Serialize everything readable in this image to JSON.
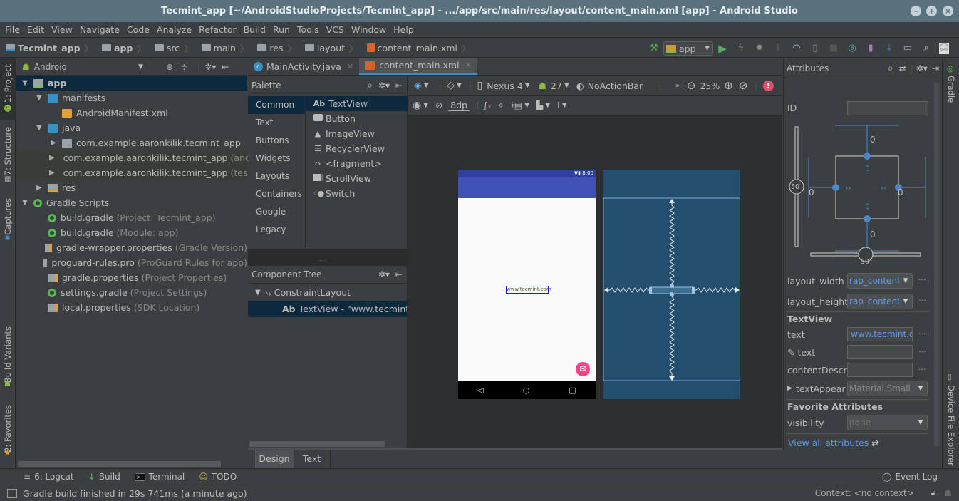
{
  "window": {
    "title": "Tecmint_app [~/AndroidStudioProjects/Tecmint_app] - .../app/src/main/res/layout/content_main.xml [app] - Android Studio",
    "controls": [
      "minimize",
      "maximize",
      "close"
    ]
  },
  "menu": [
    "File",
    "Edit",
    "View",
    "Navigate",
    "Code",
    "Analyze",
    "Refactor",
    "Build",
    "Run",
    "Tools",
    "VCS",
    "Window",
    "Help"
  ],
  "breadcrumb": [
    "Tecmint_app",
    "app",
    "src",
    "main",
    "res",
    "layout",
    "content_main.xml"
  ],
  "toolbar": {
    "run_config": "app",
    "icons": [
      "make-project-icon",
      "run-icon",
      "apply-changes-icon",
      "debug-icon",
      "attach-debugger-icon",
      "profile-icon",
      "attach-process-icon",
      "stop-icon",
      "sync-gradle-icon",
      "avd-manager-icon",
      "sdk-manager-icon",
      "project-structure-icon",
      "search-icon",
      "user-icon"
    ]
  },
  "left_strip": {
    "project": "1: Project",
    "structure": "7: Structure",
    "captures": "Captures",
    "build_variants": "Build Variants",
    "favorites": "2: Favorites"
  },
  "right_strip": {
    "gradle": "Gradle",
    "device_explorer": "Device File Explorer"
  },
  "project_panel": {
    "view_mode": "Android",
    "tree": [
      {
        "label": "app",
        "hint": "",
        "level": 0,
        "expanded": true,
        "icon": "module",
        "selected": true
      },
      {
        "label": "manifests",
        "hint": "",
        "level": 1,
        "expanded": true,
        "icon": "folder"
      },
      {
        "label": "AndroidManifest.xml",
        "hint": "",
        "level": 2,
        "icon": "manifest"
      },
      {
        "label": "java",
        "hint": "",
        "level": 1,
        "expanded": true,
        "icon": "folder"
      },
      {
        "label": "com.example.aaronkilik.tecmint_app",
        "hint": "",
        "level": 2,
        "collapsed": true,
        "icon": "package"
      },
      {
        "label": "com.example.aaronkilik.tecmint_app",
        "hint": "(andro",
        "level": 2,
        "collapsed": true,
        "icon": "package",
        "alt": true
      },
      {
        "label": "com.example.aaronkilik.tecmint_app",
        "hint": "(test)",
        "level": 2,
        "collapsed": true,
        "icon": "package",
        "alt": true
      },
      {
        "label": "res",
        "hint": "",
        "level": 1,
        "collapsed": true,
        "icon": "res"
      },
      {
        "label": "Gradle Scripts",
        "hint": "",
        "level": 0,
        "expanded": true,
        "icon": "gradle"
      },
      {
        "label": "build.gradle",
        "hint": "(Project: Tecmint_app)",
        "level": 1,
        "icon": "gradle"
      },
      {
        "label": "build.gradle",
        "hint": "(Module: app)",
        "level": 1,
        "icon": "gradle"
      },
      {
        "label": "gradle-wrapper.properties",
        "hint": "(Gradle Version)",
        "level": 1,
        "icon": "properties"
      },
      {
        "label": "proguard-rules.pro",
        "hint": "(ProGuard Rules for app)",
        "level": 1,
        "icon": "text"
      },
      {
        "label": "gradle.properties",
        "hint": "(Project Properties)",
        "level": 1,
        "icon": "properties"
      },
      {
        "label": "settings.gradle",
        "hint": "(Project Settings)",
        "level": 1,
        "icon": "gradle"
      },
      {
        "label": "local.properties",
        "hint": "(SDK Location)",
        "level": 1,
        "icon": "properties"
      }
    ]
  },
  "editor_tabs": [
    {
      "label": "MainActivity.java",
      "active": false
    },
    {
      "label": "content_main.xml",
      "active": true
    }
  ],
  "palette": {
    "title": "Palette",
    "categories": [
      "Common",
      "Text",
      "Buttons",
      "Widgets",
      "Layouts",
      "Containers",
      "Google",
      "Legacy"
    ],
    "active_category": "Common",
    "items": [
      {
        "label": "TextView",
        "icon": "Ab"
      },
      {
        "label": "Button",
        "icon": "button"
      },
      {
        "label": "ImageView",
        "icon": "image"
      },
      {
        "label": "RecyclerView",
        "icon": "list"
      },
      {
        "label": "<fragment>",
        "icon": "code"
      },
      {
        "label": "ScrollView",
        "icon": "scroll"
      },
      {
        "label": "Switch",
        "icon": "switch"
      }
    ]
  },
  "component_tree": {
    "title": "Component Tree",
    "root": "ConstraintLayout",
    "child": "TextView - \"www.tecmint.com\""
  },
  "design_toolbar": {
    "device": "Nexus 4",
    "api": "27",
    "theme": "NoActionBar",
    "zoom": "25%",
    "margin": "8dp"
  },
  "preview": {
    "status_time": "8:00",
    "textview_text": "www.tecmint.com"
  },
  "design_tabs": [
    "Design",
    "Text"
  ],
  "design_tabs_active": "Design",
  "attributes": {
    "title": "Attributes",
    "id_label": "ID",
    "id_value": "",
    "constraints": {
      "top": "0",
      "bottom": "0",
      "left": "0",
      "right": "0",
      "vertical_bias": "50",
      "horizontal_bias": "50"
    },
    "layout_width_label": "layout_width",
    "layout_width": "rap_content",
    "layout_height_label": "layout_height",
    "layout_height": "rap_content",
    "textview_section": "TextView",
    "text_label": "text",
    "text_value": "www.tecmint.c",
    "tools_text_label": "text",
    "tools_text_value": "",
    "content_desc_label": "contentDescri",
    "content_desc_value": "",
    "text_appearance_label": "textAppear",
    "text_appearance_value": "Material.Small",
    "favorites_section": "Favorite Attributes",
    "visibility_label": "visibility",
    "visibility_value": "none",
    "view_all": "View all attributes"
  },
  "bottom_tools": [
    {
      "label": "6: Logcat",
      "icon": "logcat-icon"
    },
    {
      "label": "Build",
      "icon": "build-icon"
    },
    {
      "label": "Terminal",
      "icon": "terminal-icon"
    },
    {
      "label": "TODO",
      "icon": "todo-icon"
    }
  ],
  "event_log": "Event Log",
  "status": {
    "message": "Gradle build finished in 29s 741ms (a minute ago)",
    "context": "Context: <no context>"
  }
}
